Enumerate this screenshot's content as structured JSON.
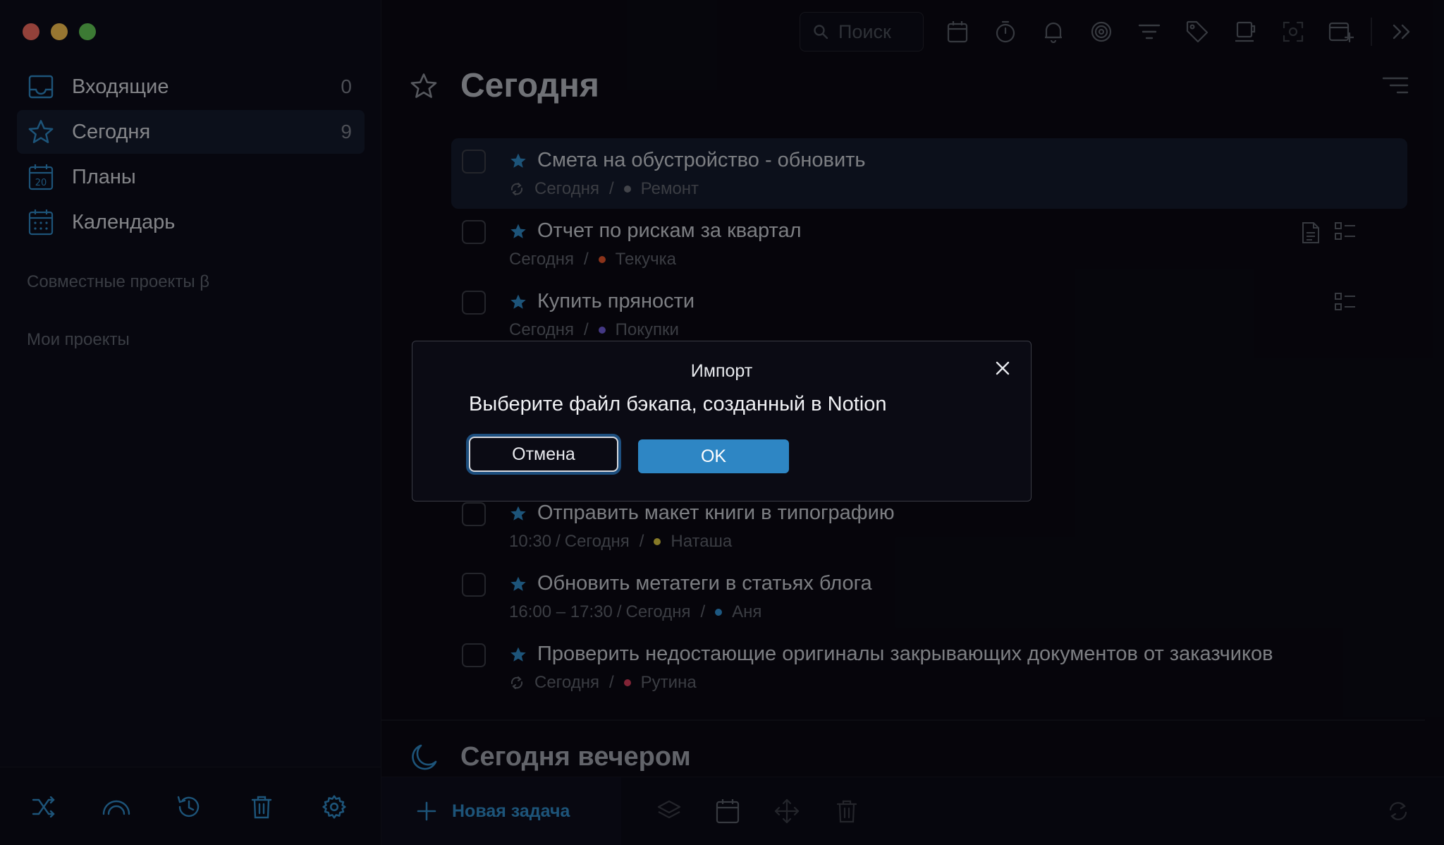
{
  "colors": {
    "accent": "#2f88c4",
    "close_dot": "#ed6a5e",
    "minimize_dot": "#f4bf4f",
    "zoom_dot": "#61c554",
    "tag_remont": "#6b6f78",
    "tag_tekuchka": "#e0532b",
    "tag_pokupki": "#6e5bd6",
    "tag_natasha": "#d9c640",
    "tag_anya": "#2f8fd0",
    "tag_rutina": "#d23a58"
  },
  "sidebar": {
    "items": [
      {
        "label": "Входящие",
        "count": "0",
        "icon": "inbox-icon"
      },
      {
        "label": "Сегодня",
        "count": "9",
        "icon": "star-icon"
      },
      {
        "label": "Планы",
        "count": "",
        "icon": "calendar-20-icon"
      },
      {
        "label": "Календарь",
        "count": "",
        "icon": "calendar-grid-icon"
      }
    ],
    "shared_projects": "Совместные проекты β",
    "my_projects": "Мои проекты",
    "bottom_icons": [
      "shuffle-icon",
      "rainbow-icon",
      "history-icon",
      "trash-icon",
      "settings-icon"
    ]
  },
  "toolbar": {
    "search_placeholder": "Поиск",
    "icons": [
      "calendar-icon",
      "timer-icon",
      "bell-icon",
      "focus-icon",
      "filter-icon",
      "tag-icon",
      "coffee-icon",
      "screenshot-icon",
      "add-calendar-icon",
      "collapse-icon"
    ]
  },
  "main": {
    "title": "Сегодня",
    "tasks": [
      {
        "title": "Смета на обустройство - обновить",
        "repeat": true,
        "time": "",
        "date": "Сегодня",
        "tag": "Ремонт"
      },
      {
        "title": "Отчет по рискам за квартал",
        "repeat": false,
        "time": "",
        "date": "Сегодня",
        "tag": "Текучка"
      },
      {
        "title": "Купить пряности",
        "repeat": false,
        "time": "",
        "date": "Сегодня",
        "tag": "Покупки"
      },
      {
        "title": "Отправить макет книги в типографию",
        "repeat": false,
        "time": "10:30",
        "date": "Сегодня",
        "tag": "Наташа"
      },
      {
        "title": "Обновить метатеги в статьях блога",
        "repeat": false,
        "time": "16:00 – 17:30",
        "date": "Сегодня",
        "tag": "Аня"
      },
      {
        "title": "Проверить недостающие оригиналы закрывающих документов от заказчиков",
        "repeat": true,
        "time": "",
        "date": "Сегодня",
        "tag": "Рутина"
      }
    ],
    "evening_title": "Сегодня вечером"
  },
  "bottom_bar": {
    "new_task_label": "Новая задача",
    "icons": [
      "layers-icon",
      "calendar-icon",
      "move-icon",
      "trash-icon",
      "sync-icon"
    ]
  },
  "dialog": {
    "title": "Импорт",
    "message": "Выберите файл бэкапа, созданный в Notion",
    "cancel_label": "Отмена",
    "ok_label": "OK"
  }
}
